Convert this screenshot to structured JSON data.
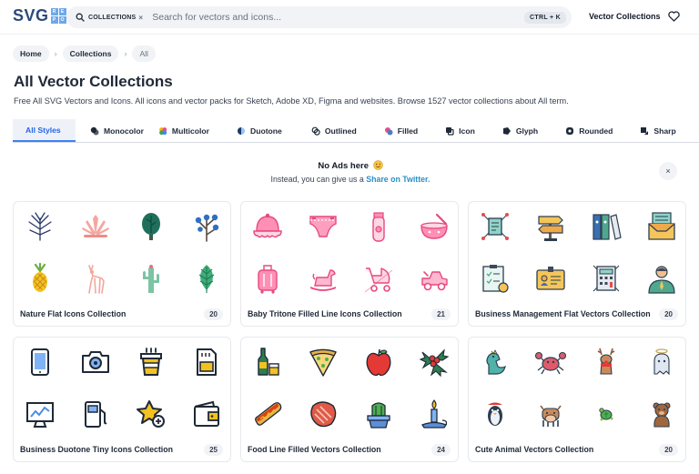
{
  "header": {
    "logo": "SVG",
    "logo_mark": [
      "R",
      "E",
      "P",
      "O"
    ],
    "search_scope": "COLLECTIONS",
    "search_scope_clear": "×",
    "search_placeholder": "Search for vectors and icons...",
    "shortcut": "CTRL + K",
    "nav_link": "Vector Collections"
  },
  "breadcrumb": [
    "Home",
    "Collections",
    "All"
  ],
  "title": "All Vector Collections",
  "description": "Free All SVG Vectors and Icons. All icons and vector packs for Sketch, Adobe XD, Figma and websites. Browse 1527 vector collections about All term.",
  "tabs": [
    {
      "label": "All Styles",
      "icon": "none"
    },
    {
      "label": "Monocolor",
      "icon": "monocolor-icon"
    },
    {
      "label": "Multicolor",
      "icon": "multicolor-icon"
    },
    {
      "label": "Duotone",
      "icon": "duotone-icon"
    },
    {
      "label": "Outlined",
      "icon": "outlined-icon"
    },
    {
      "label": "Filled",
      "icon": "filled-icon"
    },
    {
      "label": "Icon",
      "icon": "icon-style-icon"
    },
    {
      "label": "Glyph",
      "icon": "glyph-icon"
    },
    {
      "label": "Rounded",
      "icon": "rounded-icon"
    },
    {
      "label": "Sharp",
      "icon": "sharp-icon"
    }
  ],
  "ad": {
    "title": "No Ads here",
    "text": "Instead, you can give us a",
    "link": "Share on Twitter.",
    "close": "×"
  },
  "collections": [
    {
      "name": "Nature Flat Icons Collection",
      "count": "20",
      "icons": [
        "palm-leaf-icon",
        "agave-icon",
        "tree-icon",
        "berry-branch-icon",
        "pineapple-icon",
        "deer-icon",
        "cactus-icon",
        "leaf-icon"
      ]
    },
    {
      "name": "Baby Tritone Filled Line Icons Collection",
      "count": "21",
      "icons": [
        "baby-hat-icon",
        "diaper-icon",
        "trimmer-icon",
        "baby-bowl-icon",
        "luggage-icon",
        "rocking-horse-icon",
        "stroller-icon",
        "ride-on-car-icon"
      ]
    },
    {
      "name": "Business Management Flat Vectors Collection",
      "count": "20",
      "icons": [
        "document-network-icon",
        "signpost-icon",
        "binders-icon",
        "archive-box-icon",
        "checklist-icon",
        "id-card-icon",
        "calculator-icon",
        "manager-icon"
      ]
    },
    {
      "name": "Business Duotone Tiny Icons Collection",
      "count": "25",
      "icons": [
        "tablet-icon",
        "camera-icon",
        "coffee-cup-icon",
        "sd-card-icon",
        "analytics-monitor-icon",
        "fuel-pump-icon",
        "star-add-icon",
        "wallet-icon"
      ]
    },
    {
      "name": "Food Line Filled Vectors Collection",
      "count": "24",
      "icons": [
        "bottle-glass-icon",
        "pizza-icon",
        "apple-icon",
        "holly-icon",
        "hotdog-icon",
        "steak-icon",
        "cactus-pot-icon",
        "candle-icon"
      ]
    },
    {
      "name": "Cute Animal Vectors Collection",
      "count": "20",
      "icons": [
        "dinosaur-icon",
        "crab-icon",
        "reindeer-icon",
        "angel-ghost-icon",
        "penguin-icon",
        "cow-icon",
        "turtle-icon",
        "bear-icon"
      ]
    }
  ]
}
